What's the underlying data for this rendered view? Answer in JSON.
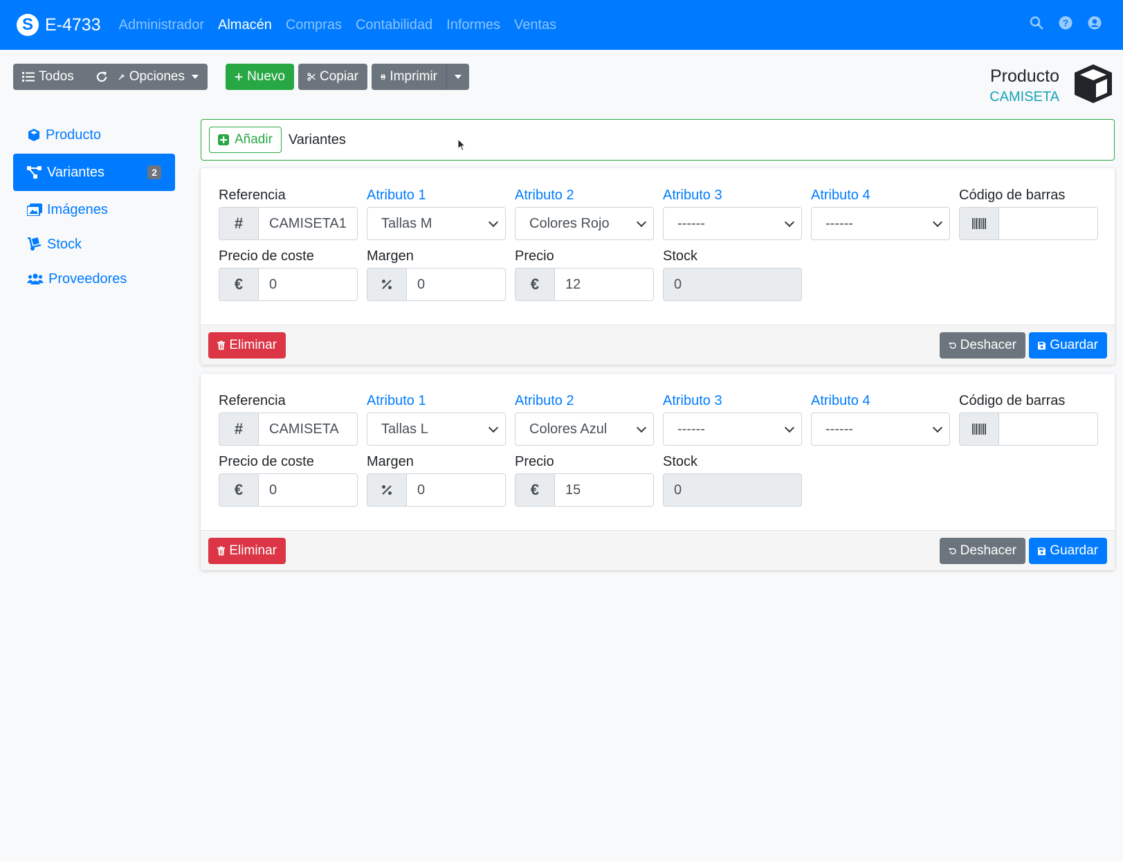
{
  "navbar": {
    "brand": "E-4733",
    "logo_letter": "S",
    "links": [
      {
        "label": "Administrador",
        "active": false
      },
      {
        "label": "Almacén",
        "active": true
      },
      {
        "label": "Compras",
        "active": false
      },
      {
        "label": "Contabilidad",
        "active": false
      },
      {
        "label": "Informes",
        "active": false
      },
      {
        "label": "Ventas",
        "active": false
      }
    ],
    "icons": [
      "search-icon",
      "help-icon",
      "user-icon"
    ]
  },
  "toolbar": {
    "all_label": "Todos",
    "options_label": "Opciones",
    "new_label": "Nuevo",
    "copy_label": "Copiar",
    "print_label": "Imprimir"
  },
  "page": {
    "title": "Producto",
    "subtitle": "CAMISETA"
  },
  "sidebar": {
    "items": [
      {
        "label": "Producto",
        "icon": "cube-icon",
        "active": false
      },
      {
        "label": "Variantes",
        "icon": "sitemap-icon",
        "active": true,
        "badge": "2"
      },
      {
        "label": "Imágenes",
        "icon": "images-icon",
        "active": false
      },
      {
        "label": "Stock",
        "icon": "dolly-icon",
        "active": false
      },
      {
        "label": "Proveedores",
        "icon": "users-icon",
        "active": false
      }
    ]
  },
  "add_bar": {
    "button_label": "Añadir",
    "title": "Variantes"
  },
  "labels": {
    "reference": "Referencia",
    "attr1": "Atributo 1",
    "attr2": "Atributo 2",
    "attr3": "Atributo 3",
    "attr4": "Atributo 4",
    "barcode": "Código de barras",
    "cost_price": "Precio de coste",
    "margin": "Margen",
    "price": "Precio",
    "stock": "Stock",
    "delete": "Eliminar",
    "undo": "Deshacer",
    "save": "Guardar",
    "hash": "#",
    "euro": "€"
  },
  "variants": [
    {
      "reference": "CAMISETA1",
      "attr1": "Tallas M",
      "attr2": "Colores Rojo",
      "attr3": "------",
      "attr4": "------",
      "barcode": "",
      "cost_price": "0",
      "margin": "0",
      "price": "12",
      "stock": "0"
    },
    {
      "reference": "CAMISETA",
      "attr1": "Tallas L",
      "attr2": "Colores Azul",
      "attr3": "------",
      "attr4": "------",
      "barcode": "",
      "cost_price": "0",
      "margin": "0",
      "price": "15",
      "stock": "0"
    }
  ],
  "colors": {
    "primary": "#007bff",
    "success": "#28a745",
    "danger": "#dc3545",
    "secondary": "#6c757d",
    "info": "#17a2b8"
  }
}
